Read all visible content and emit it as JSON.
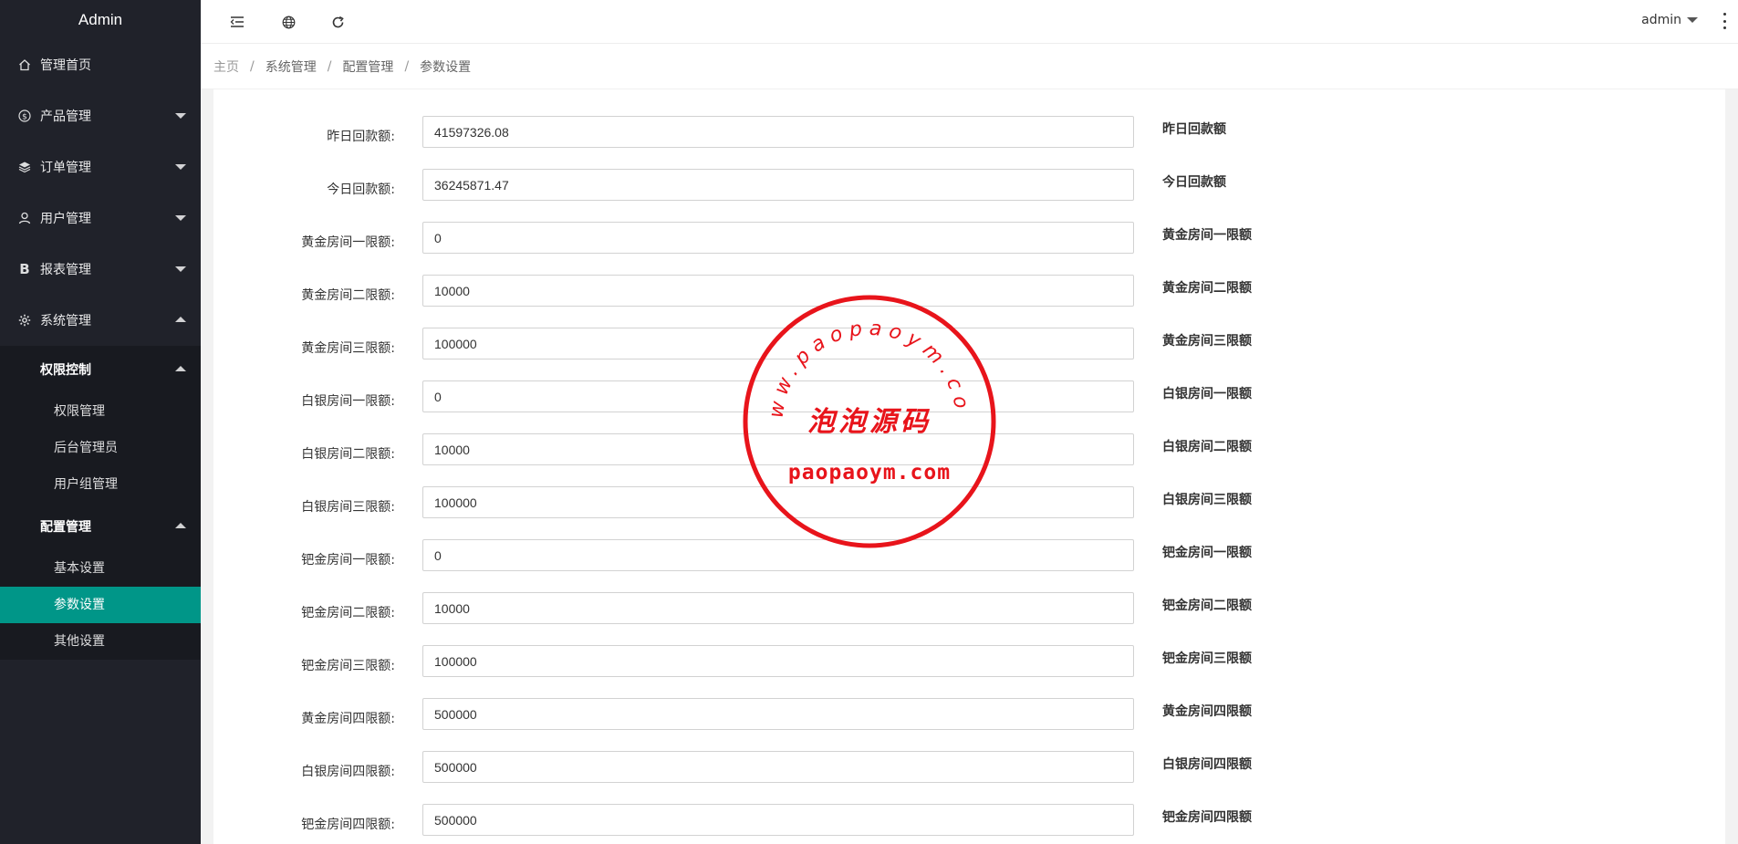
{
  "sidebar": {
    "logo": "Admin",
    "items": [
      {
        "label": "管理首页",
        "icon": "home-icon"
      },
      {
        "label": "产品管理",
        "icon": "dollar-icon"
      },
      {
        "label": "订单管理",
        "icon": "layers-icon"
      },
      {
        "label": "用户管理",
        "icon": "user-icon"
      },
      {
        "label": "报表管理",
        "icon": "bold-b-icon"
      },
      {
        "label": "系统管理",
        "icon": "gear-icon"
      }
    ],
    "groups": [
      {
        "label": "权限控制",
        "children": [
          "权限管理",
          "后台管理员",
          "用户组管理"
        ]
      },
      {
        "label": "配置管理",
        "children": [
          "基本设置",
          "参数设置",
          "其他设置"
        ]
      }
    ],
    "active_item": "参数设置"
  },
  "header": {
    "user": "admin",
    "icons": [
      "menu-fold-icon",
      "globe-icon",
      "refresh-icon",
      "more-vertical-icon"
    ]
  },
  "breadcrumb": [
    "主页",
    "系统管理",
    "配置管理",
    "参数设置"
  ],
  "form": {
    "rows": [
      {
        "label": "昨日回款额:",
        "value": "41597326.08",
        "hint": "昨日回款额"
      },
      {
        "label": "今日回款额:",
        "value": "36245871.47",
        "hint": "今日回款额"
      },
      {
        "label": "黄金房间一限额:",
        "value": "0",
        "hint": "黄金房间一限额"
      },
      {
        "label": "黄金房间二限额:",
        "value": "10000",
        "hint": "黄金房间二限额"
      },
      {
        "label": "黄金房间三限额:",
        "value": "100000",
        "hint": "黄金房间三限额"
      },
      {
        "label": "白银房间一限额:",
        "value": "0",
        "hint": "白银房间一限额"
      },
      {
        "label": "白银房间二限额:",
        "value": "10000",
        "hint": "白银房间二限额"
      },
      {
        "label": "白银房间三限额:",
        "value": "100000",
        "hint": "白银房间三限额"
      },
      {
        "label": "钯金房间一限额:",
        "value": "0",
        "hint": "钯金房间一限额"
      },
      {
        "label": "钯金房间二限额:",
        "value": "10000",
        "hint": "钯金房间二限额"
      },
      {
        "label": "钯金房间三限额:",
        "value": "100000",
        "hint": "钯金房间三限额"
      },
      {
        "label": "黄金房间四限额:",
        "value": "500000",
        "hint": "黄金房间四限额"
      },
      {
        "label": "白银房间四限额:",
        "value": "500000",
        "hint": "白银房间四限额"
      },
      {
        "label": "钯金房间四限额:",
        "value": "500000",
        "hint": "钯金房间四限额"
      }
    ]
  },
  "watermark": {
    "arc_text": "www.paopaoym.com",
    "center_text": "泡泡源码",
    "bottom_text": "paopaoym.com",
    "color": "#e8141b"
  }
}
